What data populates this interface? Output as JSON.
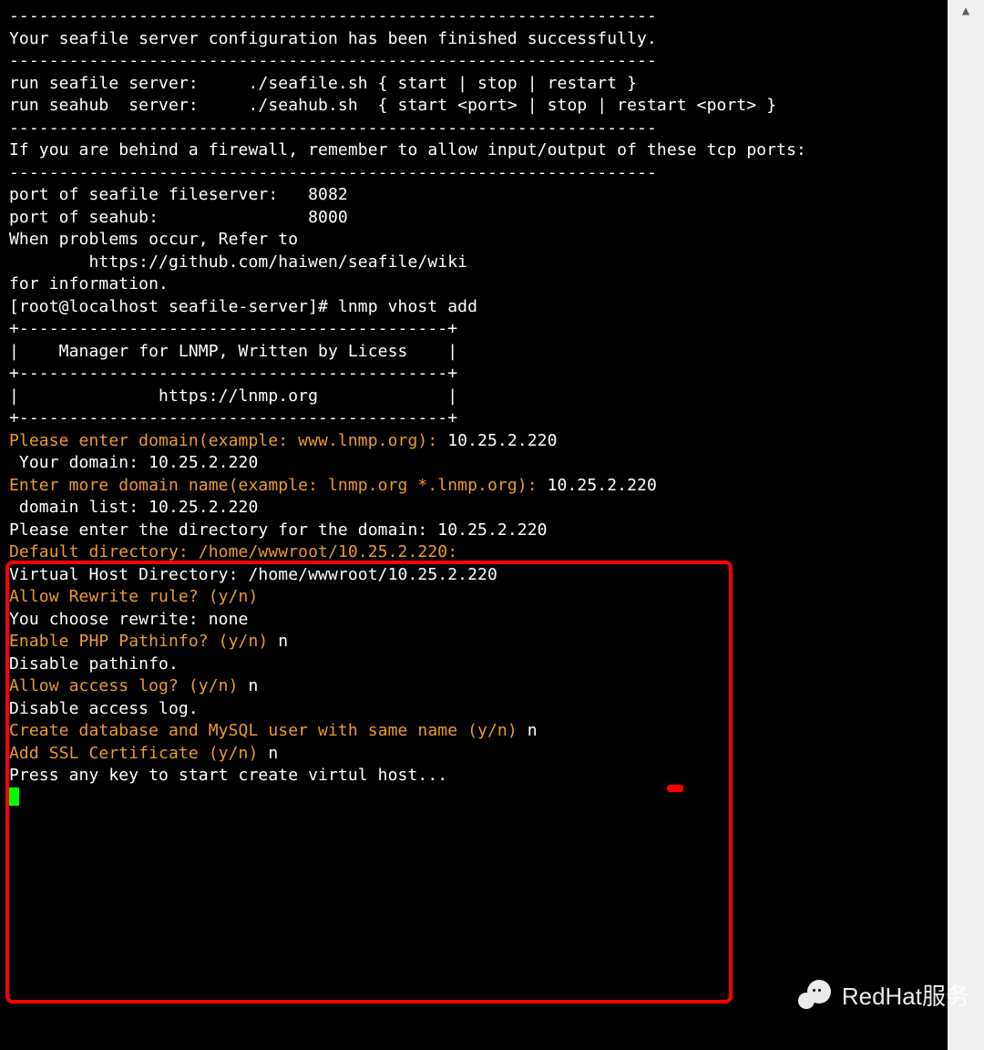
{
  "lines": [
    {
      "segs": [
        {
          "cls": "white",
          "t": "-----------------------------------------------------------------"
        }
      ]
    },
    {
      "segs": [
        {
          "cls": "white",
          "t": "Your seafile server configuration has been finished successfully."
        }
      ]
    },
    {
      "segs": [
        {
          "cls": "white",
          "t": "-----------------------------------------------------------------"
        }
      ]
    },
    {
      "segs": [
        {
          "cls": "white",
          "t": ""
        }
      ]
    },
    {
      "segs": [
        {
          "cls": "white",
          "t": "run seafile server:     ./seafile.sh { start | stop | restart }"
        }
      ]
    },
    {
      "segs": [
        {
          "cls": "white",
          "t": "run seahub  server:     ./seahub.sh  { start <port> | stop | restart <port> }"
        }
      ]
    },
    {
      "segs": [
        {
          "cls": "white",
          "t": ""
        }
      ]
    },
    {
      "segs": [
        {
          "cls": "white",
          "t": "-----------------------------------------------------------------"
        }
      ]
    },
    {
      "segs": [
        {
          "cls": "white",
          "t": "If you are behind a firewall, remember to allow input/output of these tcp ports:"
        }
      ]
    },
    {
      "segs": [
        {
          "cls": "white",
          "t": "-----------------------------------------------------------------"
        }
      ]
    },
    {
      "segs": [
        {
          "cls": "white",
          "t": ""
        }
      ]
    },
    {
      "segs": [
        {
          "cls": "white",
          "t": "port of seafile fileserver:   8082"
        }
      ]
    },
    {
      "segs": [
        {
          "cls": "white",
          "t": "port of seahub:               8000"
        }
      ]
    },
    {
      "segs": [
        {
          "cls": "white",
          "t": ""
        }
      ]
    },
    {
      "segs": [
        {
          "cls": "white",
          "t": "When problems occur, Refer to"
        }
      ]
    },
    {
      "segs": [
        {
          "cls": "white",
          "t": ""
        }
      ]
    },
    {
      "segs": [
        {
          "cls": "white",
          "t": "        https://github.com/haiwen/seafile/wiki"
        }
      ]
    },
    {
      "segs": [
        {
          "cls": "white",
          "t": ""
        }
      ]
    },
    {
      "segs": [
        {
          "cls": "white",
          "t": "for information."
        }
      ]
    },
    {
      "segs": [
        {
          "cls": "white",
          "t": ""
        }
      ]
    },
    {
      "segs": [
        {
          "cls": "white",
          "t": ""
        }
      ]
    },
    {
      "segs": [
        {
          "cls": "white",
          "t": "[root@localhost seafile-server]# lnmp vhost add"
        }
      ]
    },
    {
      "segs": [
        {
          "cls": "white",
          "t": "+-------------------------------------------+"
        }
      ]
    },
    {
      "segs": [
        {
          "cls": "white",
          "t": "|    Manager for LNMP, Written by Licess    |"
        }
      ]
    },
    {
      "segs": [
        {
          "cls": "white",
          "t": "+-------------------------------------------+"
        }
      ]
    },
    {
      "segs": [
        {
          "cls": "white",
          "t": "|              https://lnmp.org             |"
        }
      ]
    },
    {
      "segs": [
        {
          "cls": "white",
          "t": "+-------------------------------------------+"
        }
      ]
    },
    {
      "segs": [
        {
          "cls": "orange",
          "t": "Please enter domain(example: www.lnmp.org): "
        },
        {
          "cls": "white",
          "t": "10.25.2.220"
        }
      ]
    },
    {
      "segs": [
        {
          "cls": "white",
          "t": " Your domain: 10.25.2.220"
        }
      ]
    },
    {
      "segs": [
        {
          "cls": "orange",
          "t": "Enter more domain name(example: lnmp.org *.lnmp.org): "
        },
        {
          "cls": "white",
          "t": "10.25.2.220"
        }
      ]
    },
    {
      "segs": [
        {
          "cls": "white",
          "t": " domain list: 10.25.2.220"
        }
      ]
    },
    {
      "segs": [
        {
          "cls": "white",
          "t": "Please enter the directory for the domain: 10.25.2.220"
        }
      ]
    },
    {
      "segs": [
        {
          "cls": "orange",
          "t": "Default directory: /home/wwwroot/10.25.2.220:"
        }
      ]
    },
    {
      "segs": [
        {
          "cls": "white",
          "t": "Virtual Host Directory: /home/wwwroot/10.25.2.220"
        }
      ]
    },
    {
      "segs": [
        {
          "cls": "orange",
          "t": "Allow Rewrite rule? (y/n) "
        }
      ]
    },
    {
      "segs": [
        {
          "cls": "white",
          "t": "You choose rewrite: none"
        }
      ]
    },
    {
      "segs": [
        {
          "cls": "orange",
          "t": "Enable PHP Pathinfo? (y/n) "
        },
        {
          "cls": "white",
          "t": "n"
        }
      ]
    },
    {
      "segs": [
        {
          "cls": "white",
          "t": "Disable pathinfo."
        }
      ]
    },
    {
      "segs": [
        {
          "cls": "orange",
          "t": "Allow access log? (y/n) "
        },
        {
          "cls": "white",
          "t": "n"
        }
      ]
    },
    {
      "segs": [
        {
          "cls": "white",
          "t": "Disable access log."
        }
      ]
    },
    {
      "segs": [
        {
          "cls": "orange",
          "t": "Create database and MySQL user with same name (y/n) "
        },
        {
          "cls": "white",
          "t": "n"
        }
      ]
    },
    {
      "segs": [
        {
          "cls": "orange",
          "t": "Add SSL Certificate (y/n) "
        },
        {
          "cls": "white",
          "t": "n"
        }
      ]
    },
    {
      "segs": [
        {
          "cls": "white",
          "t": ""
        }
      ]
    },
    {
      "segs": [
        {
          "cls": "white",
          "t": "Press any key to start create virtul host..."
        }
      ]
    }
  ],
  "watermark": "RedHat服务",
  "scroll_arrow_up": "▲"
}
